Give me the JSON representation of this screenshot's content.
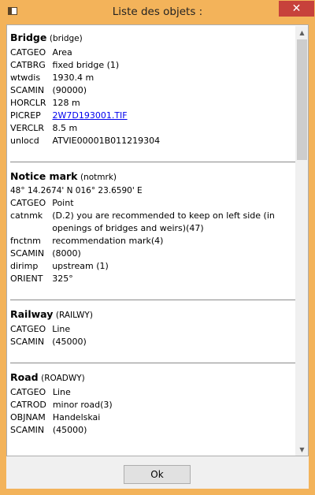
{
  "window": {
    "title": "Liste des objets :",
    "close_glyph": "✕",
    "icon": "app-window-icon"
  },
  "objects": [
    {
      "name": "Bridge",
      "code": "(bridge)",
      "coords": "",
      "attributes": [
        {
          "key": "CATGEO",
          "value": "Area"
        },
        {
          "key": "CATBRG",
          "value": "fixed bridge (1)"
        },
        {
          "key": "wtwdis",
          "value": "1930.4 m"
        },
        {
          "key": "SCAMIN",
          "value": "(90000)"
        },
        {
          "key": "HORCLR",
          "value": "128 m"
        },
        {
          "key": "PICREP",
          "value": "2W7D193001.TIF",
          "link": true
        },
        {
          "key": "VERCLR",
          "value": "8.5 m"
        },
        {
          "key": "unlocd",
          "value": "ATVIE00001B011219304"
        }
      ]
    },
    {
      "name": "Notice mark",
      "code": "(notmrk)",
      "coords": "48° 14.2674' N 016° 23.6590' E",
      "attributes": [
        {
          "key": "CATGEO",
          "value": "Point"
        },
        {
          "key": "catnmk",
          "value": "(D.2) you are recommended to keep on left side (in openings of bridges and weirs)(47)"
        },
        {
          "key": "fnctnm",
          "value": "recommendation mark(4)"
        },
        {
          "key": "SCAMIN",
          "value": "(8000)"
        },
        {
          "key": "dirimp",
          "value": "upstream (1)"
        },
        {
          "key": "ORIENT",
          "value": "325°"
        }
      ]
    },
    {
      "name": "Railway",
      "code": "(RAILWY)",
      "coords": "",
      "attributes": [
        {
          "key": "CATGEO",
          "value": "Line"
        },
        {
          "key": "SCAMIN",
          "value": "(45000)"
        }
      ]
    },
    {
      "name": "Road",
      "code": "(ROADWY)",
      "coords": "",
      "attributes": [
        {
          "key": "CATGEO",
          "value": "Line"
        },
        {
          "key": "CATROD",
          "value": "minor road(3)"
        },
        {
          "key": "OBJNAM",
          "value": "Handelskai"
        },
        {
          "key": "SCAMIN",
          "value": "(45000)"
        }
      ]
    }
  ],
  "buttons": {
    "ok_label": "Ok"
  },
  "scrollbar": {
    "up_glyph": "▲",
    "down_glyph": "▼"
  }
}
